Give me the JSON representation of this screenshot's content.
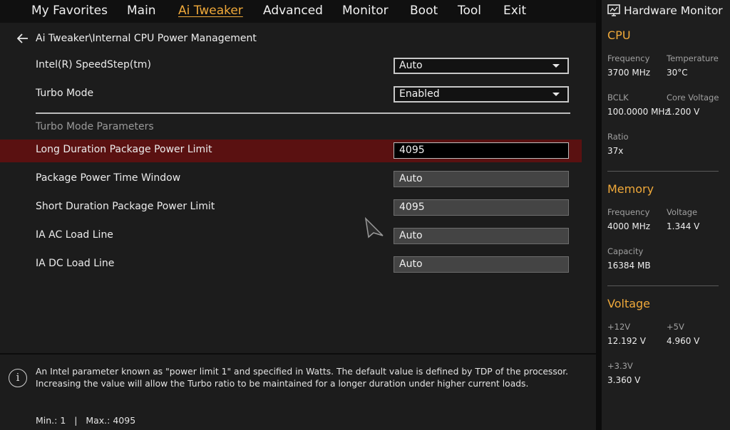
{
  "menu": {
    "tabs": [
      {
        "label": "My Favorites"
      },
      {
        "label": "Main"
      },
      {
        "label": "Ai Tweaker",
        "active": true
      },
      {
        "label": "Advanced"
      },
      {
        "label": "Monitor"
      },
      {
        "label": "Boot"
      },
      {
        "label": "Tool"
      },
      {
        "label": "Exit"
      }
    ]
  },
  "breadcrumb": "Ai Tweaker\\Internal CPU Power Management",
  "settings": {
    "speedstep": {
      "label": "Intel(R) SpeedStep(tm)",
      "value": "Auto"
    },
    "turbo_mode": {
      "label": "Turbo Mode",
      "value": "Enabled"
    },
    "section_title": "Turbo Mode Parameters",
    "long_duration": {
      "label": "Long Duration Package Power Limit",
      "value": "4095"
    },
    "time_window": {
      "label": "Package Power Time Window",
      "value": "Auto"
    },
    "short_duration": {
      "label": "Short Duration Package Power Limit",
      "value": "4095"
    },
    "ia_ac": {
      "label": "IA AC Load Line",
      "value": "Auto"
    },
    "ia_dc": {
      "label": "IA DC Load Line",
      "value": "Auto"
    }
  },
  "help": {
    "text": "An Intel parameter known as \"power limit 1\" and specified in Watts. The default value is defined by TDP of the processor. Increasing the value will allow the Turbo ratio to be maintained for a longer duration under higher current loads.",
    "range": "Min.: 1   |   Max.: 4095"
  },
  "hardware_monitor": {
    "title": "Hardware Monitor",
    "cpu": {
      "title": "CPU",
      "frequency_label": "Frequency",
      "frequency": "3700 MHz",
      "temperature_label": "Temperature",
      "temperature": "30°C",
      "bclk_label": "BCLK",
      "bclk": "100.0000 MHz",
      "core_voltage_label": "Core Voltage",
      "core_voltage": "1.200 V",
      "ratio_label": "Ratio",
      "ratio": "37x"
    },
    "memory": {
      "title": "Memory",
      "frequency_label": "Frequency",
      "frequency": "4000 MHz",
      "voltage_label": "Voltage",
      "voltage": "1.344 V",
      "capacity_label": "Capacity",
      "capacity": "16384 MB"
    },
    "voltage": {
      "title": "Voltage",
      "v12_label": "+12V",
      "v12": "12.192 V",
      "v5_label": "+5V",
      "v5": "4.960 V",
      "v33_label": "+3.3V",
      "v33": "3.360 V"
    }
  },
  "colors": {
    "accent": "#f0a93a",
    "highlight_row": "#5a1111",
    "panel": "#1c1c1c"
  }
}
